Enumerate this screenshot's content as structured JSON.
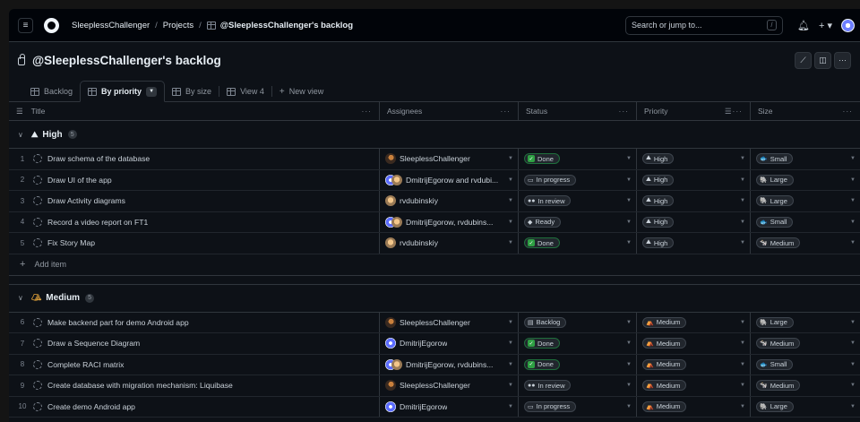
{
  "header": {
    "owner": "SleeplessChallenger",
    "projects": "Projects",
    "project": "@SleeplessChallenger's backlog",
    "search_placeholder": "Search or jump to...",
    "search_key": "/"
  },
  "page": {
    "title": "@SleeplessChallenger's backlog"
  },
  "tabs": [
    {
      "label": "Backlog"
    },
    {
      "label": "By priority"
    },
    {
      "label": "By size"
    },
    {
      "label": "View 4"
    },
    {
      "label": "New view"
    }
  ],
  "columns": {
    "title": "Title",
    "assignees": "Assignees",
    "status": "Status",
    "priority": "Priority",
    "size": "Size"
  },
  "groups": [
    {
      "label": "High",
      "count": "5",
      "rows": [
        {
          "num": "1",
          "title": "Draw schema of the database",
          "assignees": "SleeplessChallenger",
          "status": "Done",
          "priority": "High",
          "size": "Small"
        },
        {
          "num": "2",
          "title": "Draw UI of the app",
          "assignees": "DmitrijEgorow and rvdubi...",
          "status": "In progress",
          "priority": "High",
          "size": "Large"
        },
        {
          "num": "3",
          "title": "Draw Activity diagrams",
          "assignees": "rvdubinskiy",
          "status": "In review",
          "priority": "High",
          "size": "Large"
        },
        {
          "num": "4",
          "title": "Record a video report on FT1",
          "assignees": "DmitrijEgorow, rvdubins...",
          "status": "Ready",
          "priority": "High",
          "size": "Small"
        },
        {
          "num": "5",
          "title": "Fix Story Map",
          "assignees": "rvdubinskiy",
          "status": "Done",
          "priority": "High",
          "size": "Medium"
        }
      ],
      "add_item": "Add item"
    },
    {
      "label": "Medium",
      "count": "5",
      "rows": [
        {
          "num": "6",
          "title": "Make backend part for demo Android app",
          "assignees": "SleeplessChallenger",
          "status": "Backlog",
          "priority": "Medium",
          "size": "Large"
        },
        {
          "num": "7",
          "title": "Draw a Sequence Diagram",
          "assignees": "DmitrijEgorow",
          "status": "Done",
          "priority": "Medium",
          "size": "Medium"
        },
        {
          "num": "8",
          "title": "Complete RACI matrix",
          "assignees": "DmitrijEgorow, rvdubins...",
          "status": "Done",
          "priority": "Medium",
          "size": "Small"
        },
        {
          "num": "9",
          "title": "Create database with migration mechanism: Liquibase",
          "assignees": "SleeplessChallenger",
          "status": "In review",
          "priority": "Medium",
          "size": "Medium"
        },
        {
          "num": "10",
          "title": "Create demo Android app",
          "assignees": "DmitrijEgorow",
          "status": "In progress",
          "priority": "Medium",
          "size": "Large"
        }
      ]
    }
  ]
}
